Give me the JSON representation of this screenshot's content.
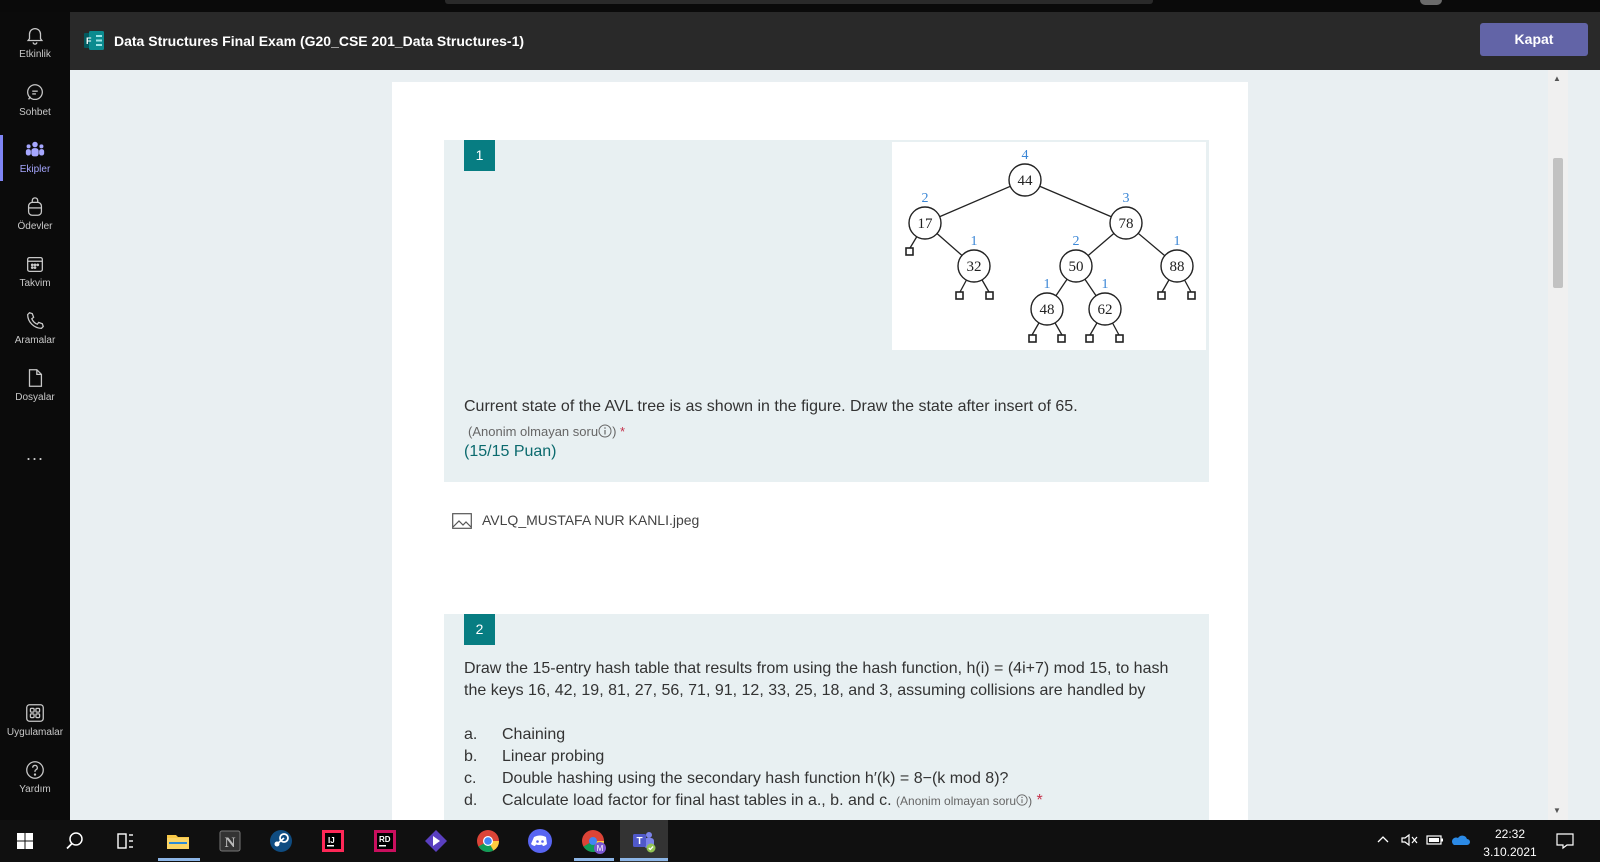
{
  "rail": {
    "items": [
      {
        "label": "Etkinlik",
        "icon": "bell-icon"
      },
      {
        "label": "Sohbet",
        "icon": "chat-icon"
      },
      {
        "label": "Ekipler",
        "icon": "teams-icon",
        "active": true
      },
      {
        "label": "Ödevler",
        "icon": "backpack-icon"
      },
      {
        "label": "Takvim",
        "icon": "calendar-icon"
      },
      {
        "label": "Aramalar",
        "icon": "phone-icon"
      },
      {
        "label": "Dosyalar",
        "icon": "file-icon"
      }
    ],
    "more": "...",
    "apps_label": "Uygulamalar",
    "help_label": "Yardım"
  },
  "header": {
    "title": "Data Structures Final Exam (G20_CSE 201_Data Structures-1)",
    "close_label": "Kapat",
    "accent": "#6264a7"
  },
  "question1": {
    "number": "1",
    "text": "Current state of the AVL tree is as shown in the figure. Draw the state after insert of 65.",
    "anon": "(Anonim olmayan soru",
    "anon_close": ")",
    "required": "*",
    "points": "(15/15 Puan)",
    "tree": {
      "nodes": [
        "44",
        "17",
        "78",
        "32",
        "50",
        "88",
        "48",
        "62"
      ],
      "heights": [
        "4",
        "2",
        "3",
        "1",
        "2",
        "1",
        "1",
        "1"
      ]
    }
  },
  "attachment": {
    "filename": "AVLQ_MUSTAFA NUR KANLI.jpeg"
  },
  "question2": {
    "number": "2",
    "text": "Draw the 15-entry hash table that results from using the hash function, h(i) = (4i+7) mod 15, to hash the keys 16, 42, 19, 81, 27, 56, 71, 91, 12, 33, 25, 18, and 3, assuming collisions are handled by",
    "options": [
      {
        "letter": "a.",
        "text": "Chaining"
      },
      {
        "letter": "b.",
        "text": "Linear probing"
      },
      {
        "letter": "c.",
        "text": "Double hashing using the secondary hash function h′(k) = 8−(k mod 8)?"
      },
      {
        "letter": "d.",
        "text": "Calculate load factor for final hast tables in a., b. and c."
      }
    ],
    "anon": "(Anonim olmayan soru",
    "anon_close": ")",
    "required": "*"
  },
  "taskbar": {
    "time": "22:32",
    "date": "3.10.2021"
  }
}
